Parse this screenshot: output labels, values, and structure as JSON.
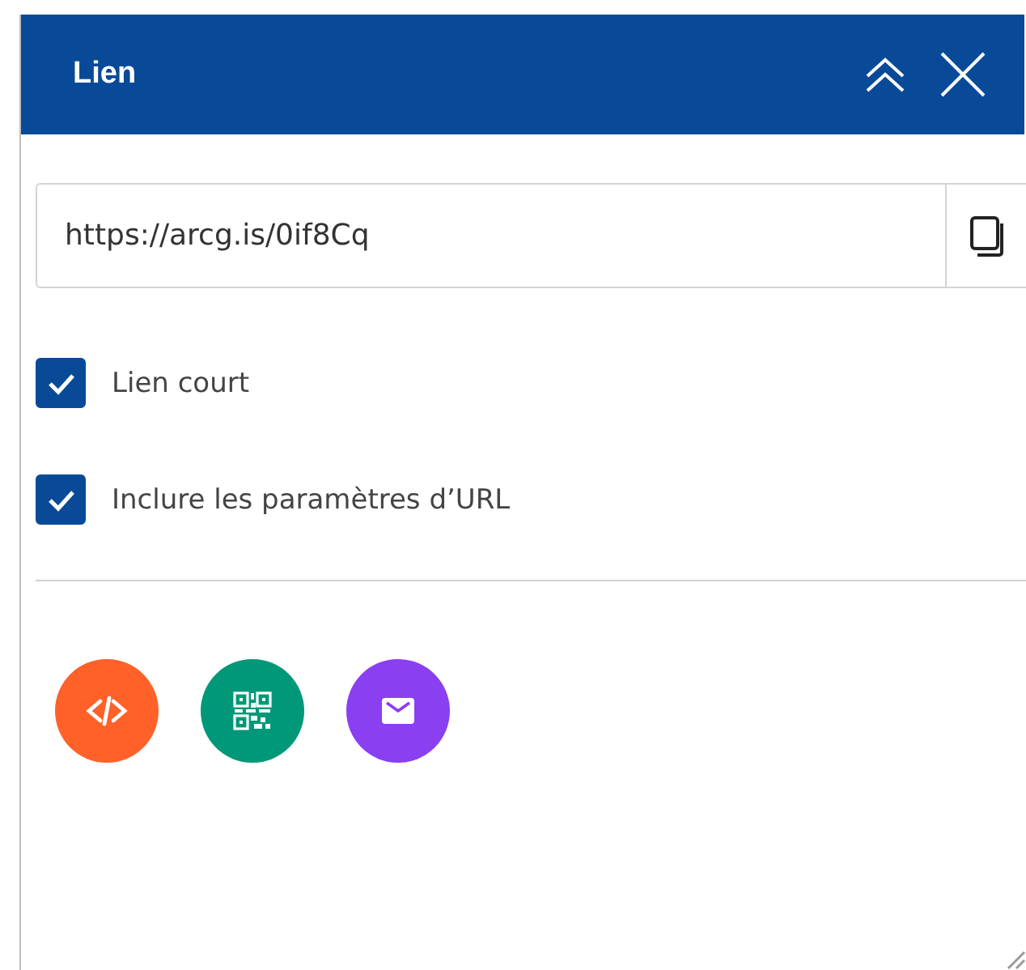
{
  "panel": {
    "title": "Lien"
  },
  "link": {
    "value": "https://arcg.is/0if8Cq"
  },
  "options": [
    {
      "label": "Lien court",
      "checked": true
    },
    {
      "label": "Inclure les paramètres d’URL",
      "checked": true
    }
  ],
  "share": [
    {
      "kind": "embed",
      "color": "#ff6128"
    },
    {
      "kind": "qr",
      "color": "#009878"
    },
    {
      "kind": "email",
      "color": "#8a3ff0"
    }
  ]
}
